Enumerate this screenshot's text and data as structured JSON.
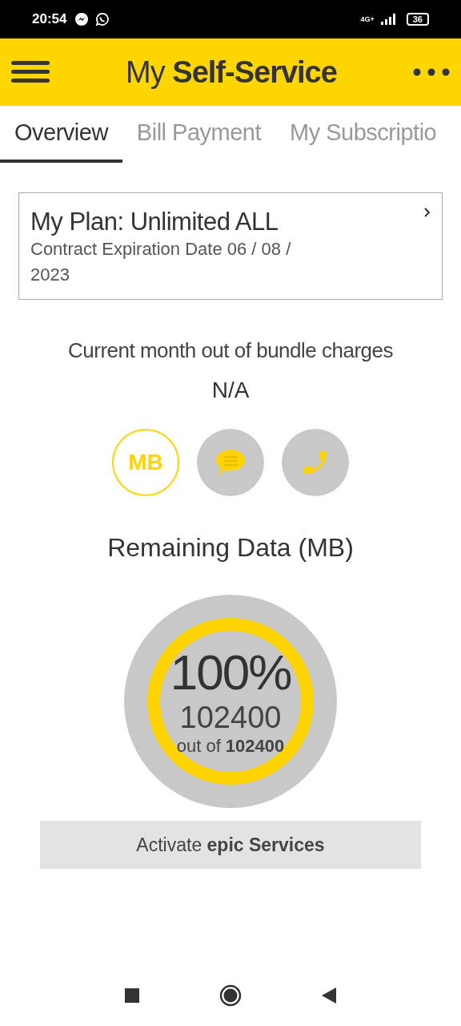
{
  "status_bar": {
    "time": "20:54",
    "network": "4G+",
    "battery": "36"
  },
  "app_bar": {
    "title": "My **Self-Service**"
  },
  "tabs": [
    {
      "label": "Overview",
      "selected": true
    },
    {
      "label": "Bill Payment",
      "selected": false
    },
    {
      "label": "My Subscriptio",
      "selected": false
    }
  ],
  "plan_card": {
    "title": "My Plan: Unlimited ALL",
    "subtitle": "Contract Expiration Date 06 / 08 / 2023"
  },
  "charges": {
    "label": "Current month out of bundle charges",
    "value": "N/A"
  },
  "usage_types": [
    {
      "kind": "data",
      "label": "MB",
      "selected": true
    },
    {
      "kind": "sms",
      "selected": false
    },
    {
      "kind": "call",
      "selected": false
    }
  ],
  "remaining": {
    "title": "Remaining Data (MB)",
    "level": 1.0,
    "percent": "100%",
    "amount": "102400",
    "total": "out of **102400**"
  },
  "activate_button": "Activate **epic Services**"
}
